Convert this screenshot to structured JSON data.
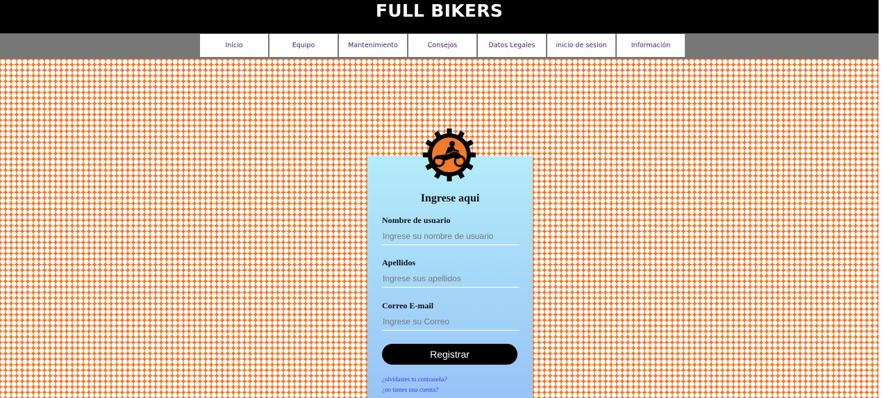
{
  "header": {
    "title": "FULL BIKERS"
  },
  "nav": {
    "items": [
      "Inicio",
      "Equipo",
      "Mantenimiento",
      "Consejos",
      "Datos Legales",
      "inicio de sesion",
      "Información"
    ]
  },
  "form": {
    "title": "Ingrese aqui",
    "username_label": "Nombre de usuario",
    "username_placeholder": "Ingrese su nombre de usuario",
    "lastname_label": "Apellidos",
    "lastname_placeholder": "Ingrese sus apellidos",
    "email_label": "Correo E-mail",
    "email_placeholder": "Ingrese su Correo",
    "submit_label": "Registrar",
    "forgot_password_link": "¿olvidastes tu contraseña?",
    "no_account_link": "¿no tienes una cuenta?"
  },
  "colors": {
    "header_bg": "#000000",
    "nav_bar_bg": "#777777",
    "nav_text": "#47206e",
    "pattern_orange": "#ef7a2b",
    "card_gradient_top": "#b3ecf9",
    "card_gradient_bottom": "#98c3f7",
    "link": "#3a3ae6"
  },
  "icons": {
    "logo": "motorcycle-gear-logo-icon"
  }
}
